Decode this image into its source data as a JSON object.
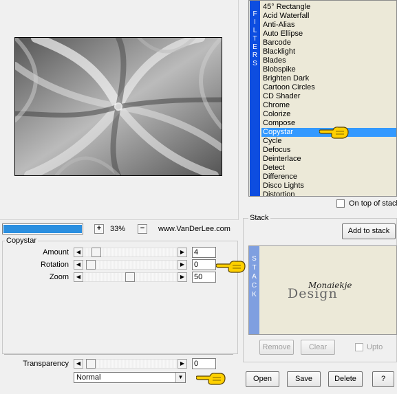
{
  "preview": {
    "zoom_level": "33%",
    "zoom_in": "+",
    "zoom_out": "−",
    "website": "www.VanDerLee.com"
  },
  "filter_group": {
    "title": "Copystar",
    "params": [
      {
        "label": "Amount",
        "value": "4"
      },
      {
        "label": "Rotation",
        "value": "0"
      },
      {
        "label": "Zoom",
        "value": "50"
      }
    ]
  },
  "transparency": {
    "label": "Transparency",
    "value": "0",
    "blend_mode": "Normal"
  },
  "filters": {
    "tab_letters": [
      "F",
      "I",
      "L",
      "T",
      "E",
      "R",
      "S"
    ],
    "items": [
      "45° Rectangle",
      "Acid Waterfall",
      "Anti-Alias",
      "Auto Ellipse",
      "Barcode",
      "Blacklight",
      "Blades",
      "Blobspike",
      "Brighten Dark",
      "Cartoon Circles",
      "CD Shader",
      "Chrome",
      "Colorize",
      "Compose",
      "Copystar",
      "Cycle",
      "Defocus",
      "Deinterlace",
      "Detect",
      "Difference",
      "Disco Lights",
      "Distortion"
    ],
    "selected": "Copystar",
    "on_top_label": "On top of stack"
  },
  "stack": {
    "title": "Stack",
    "add_button": "Add to stack",
    "tab_letters": [
      "S",
      "T",
      "A",
      "C",
      "K"
    ],
    "watermark_line1": "Monaiekje",
    "watermark_line2": "Design",
    "remove_button": "Remove",
    "clear_button": "Clear",
    "upto_label": "Upto"
  },
  "footer": {
    "open": "Open",
    "save": "Save",
    "delete": "Delete",
    "help": "?"
  },
  "colors": {
    "filters_tab": "#0d4de0",
    "stack_tab": "#7f9fe0",
    "selection": "#3399ff",
    "progress": "#2b8fe0",
    "panel_bg": "#ece9d8"
  },
  "icons": {
    "pointer": "pointing-hand-icon"
  }
}
